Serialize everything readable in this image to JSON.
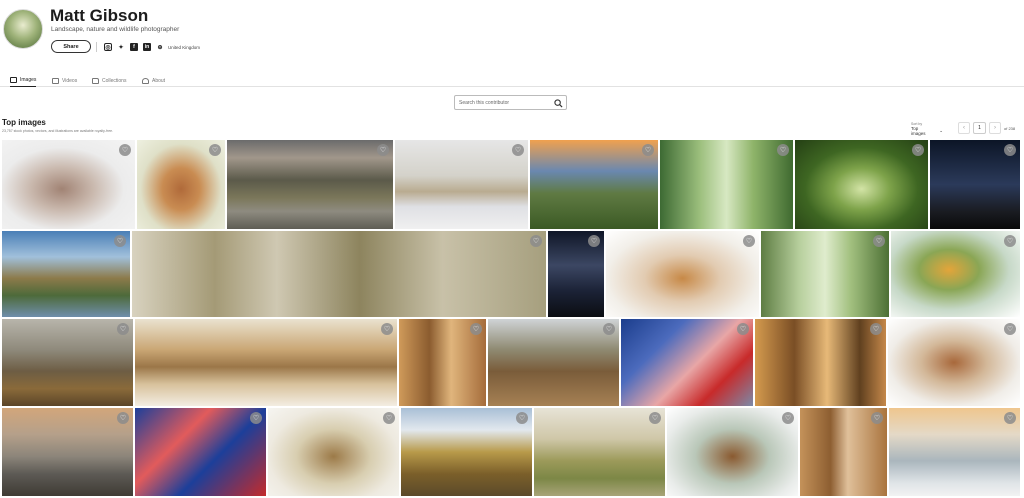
{
  "profile": {
    "name": "Matt Gibson",
    "tagline": "Landscape, nature and wildlife photographer",
    "share_label": "Share",
    "location": "United Kingdom",
    "socials": [
      "instagram-icon",
      "twitter-icon",
      "facebook-icon",
      "linkedin-icon",
      "website-icon"
    ]
  },
  "tabs": [
    {
      "label": "Images",
      "icon": "image-icon",
      "active": true
    },
    {
      "label": "Videos",
      "icon": "video-icon",
      "active": false
    },
    {
      "label": "Collections",
      "icon": "folder-icon",
      "active": false
    },
    {
      "label": "About",
      "icon": "user-icon",
      "active": false
    }
  ],
  "search": {
    "placeholder": "Search this contributor",
    "icon": "search-icon"
  },
  "results": {
    "title": "Top images",
    "subtitle": "23,757 stock photos, vectors, and illustrations are available royalty-free."
  },
  "sort": {
    "label": "Sort by",
    "value": "Top images"
  },
  "pagination": {
    "page": "1",
    "of_text": "of 238",
    "prev": "‹",
    "next": "›"
  },
  "colors": {
    "accent": "#222222",
    "heart_bg": "#8c8c8c"
  },
  "images": [
    {
      "subject": "p-deer-sketch"
    },
    {
      "subject": "p-deer-autumn"
    },
    {
      "subject": "p-mountains"
    },
    {
      "subject": "p-misty-lake"
    },
    {
      "subject": "p-book"
    },
    {
      "subject": "p-forest-deer"
    },
    {
      "subject": "p-forest-path"
    },
    {
      "subject": "p-night"
    },
    {
      "subject": "p-lakes-sky"
    },
    {
      "subject": "p-forest-pano"
    },
    {
      "subject": "p-milkyway"
    },
    {
      "subject": "p-birds"
    },
    {
      "subject": "p-forest-deer2"
    },
    {
      "subject": "p-autumn-lake"
    },
    {
      "subject": "p-stag-sky"
    },
    {
      "subject": "p-watercolor-lake"
    },
    {
      "subject": "p-forest-autumn"
    },
    {
      "subject": "p-stag-lakes"
    },
    {
      "subject": "p-flag-london"
    },
    {
      "subject": "p-autumn-woods"
    },
    {
      "subject": "p-stag-white"
    },
    {
      "subject": "p-castle"
    },
    {
      "subject": "p-bigben"
    },
    {
      "subject": "p-deer-wc"
    },
    {
      "subject": "p-stag-autumn"
    },
    {
      "subject": "p-sheep"
    },
    {
      "subject": "p-stag-teal"
    },
    {
      "subject": "p-deer-trees"
    },
    {
      "subject": "p-fog-sunrise"
    }
  ]
}
